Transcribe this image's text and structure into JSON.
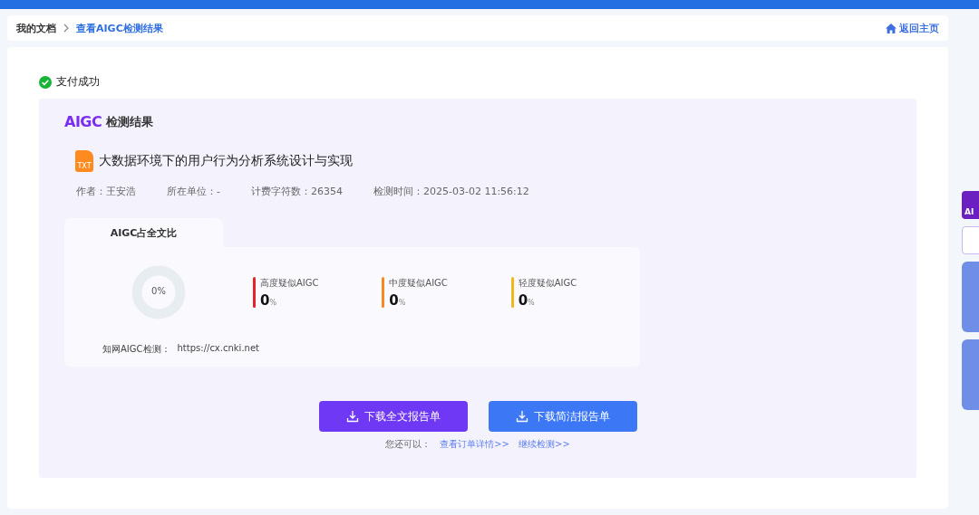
{
  "breadcrumb": {
    "items": [
      {
        "label": "我的文档",
        "selected": false
      },
      {
        "label": "查看AIGC检测结果",
        "selected": true
      }
    ],
    "home_link": "返回主页"
  },
  "status": {
    "label": "支付成功"
  },
  "result": {
    "logo": "AIGC",
    "title": "检测结果",
    "file_type": "TXT",
    "doc_title": "大数据环境下的用户行为分析系统设计与实现",
    "meta": [
      {
        "label": "作者：",
        "value": "王安浩"
      },
      {
        "label": "所在单位：",
        "value": "-"
      },
      {
        "label": "计费字符数：",
        "value": "26354"
      },
      {
        "label": "检测时间：",
        "value": "2025-03-02 11:56:12"
      }
    ],
    "tab_label": "AIGC占全文比",
    "ring": {
      "level": 0,
      "reading": "0%"
    },
    "stats": [
      {
        "label": "高度疑似AIGC",
        "value": "0",
        "unit": "%",
        "color": "#e5232b"
      },
      {
        "label": "中度疑似AIGC",
        "value": "0",
        "unit": "%",
        "color": "#f7891f"
      },
      {
        "label": "轻度疑似AIGC",
        "value": "0",
        "unit": "%",
        "color": "#f5b51c"
      }
    ],
    "source_label": "知网AIGC检测：",
    "source_url": "https://cx.cnki.net",
    "buttons": [
      {
        "label": "下载全文报告单",
        "kind": "primary"
      },
      {
        "label": "下载简洁报告单",
        "kind": "secondary"
      }
    ],
    "more_label": "您还可以：",
    "links": [
      "查看订单详情>>",
      "继续检测>>"
    ]
  },
  "side": {
    "ai_badge": "AI"
  }
}
